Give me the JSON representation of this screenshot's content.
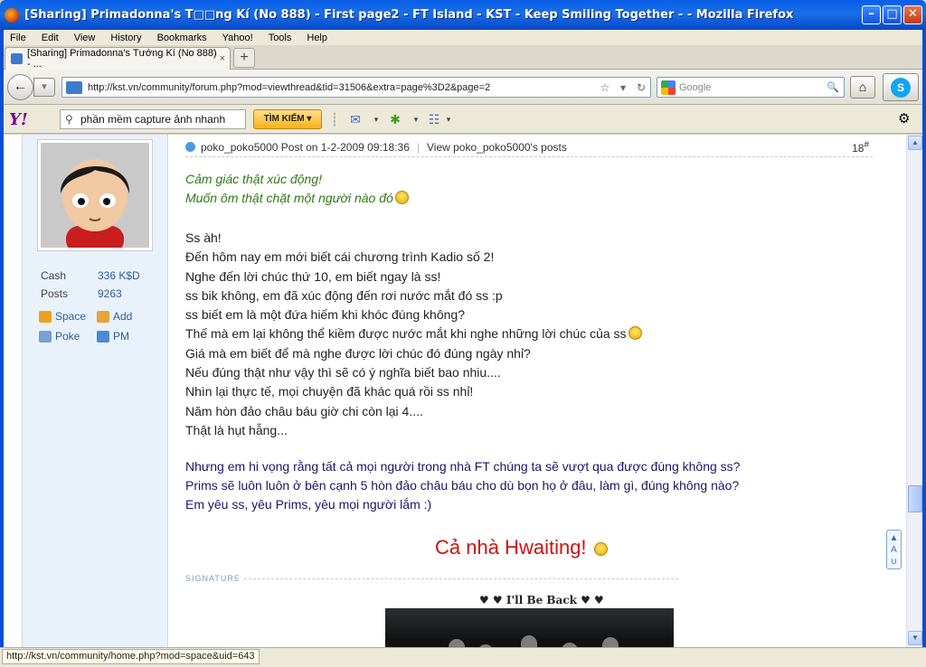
{
  "window": {
    "title": "[Sharing] Primadonna's T□□ng Kí (No 888) - First page2 - FT Island - KST - Keep Smiling Together - - Mozilla Firefox",
    "minimize": "–",
    "maximize": "□",
    "close": "✕"
  },
  "menu": [
    "File",
    "Edit",
    "View",
    "History",
    "Bookmarks",
    "Yahoo!",
    "Tools",
    "Help"
  ],
  "tabs": [
    {
      "label": "[Sharing] Primadonna's Tướng Kí (No 888) - ...",
      "close": "×"
    }
  ],
  "new_tab": "+",
  "nav": {
    "back": "←",
    "forward": "▾",
    "url": "http://kst.vn/community/forum.php?mod=viewthread&tid=31506&extra=page%3D2&page=2",
    "search_placeholder": "Google",
    "star": "☆",
    "dropdown": "▾",
    "reload": "↻",
    "home": "⌂",
    "skype": "S"
  },
  "yahoo": {
    "logo": "Y!",
    "search_value": "phần mềm capture ảnh nhanh",
    "search_button": "TÌM KIẾM ▾"
  },
  "profile": {
    "stats": [
      {
        "label": "Cash",
        "value": "336 K$D"
      },
      {
        "label": "Posts",
        "value": "9263"
      }
    ],
    "links": [
      [
        "Space",
        "Add"
      ],
      [
        "Poke",
        "PM"
      ]
    ]
  },
  "post": {
    "author": "poko_poko5000",
    "posted_on": "Post on 1-2-2009 09:18:36",
    "separator": "|",
    "view_posts": "View poko_poko5000's posts",
    "floor": "18",
    "floor_sup": "#",
    "green_lines": [
      "Cảm giác thật xúc động!",
      "Muốn ôm thật chặt một người nào đó"
    ],
    "body_lines": [
      "Ss àh!",
      "Đến hôm nay em mới biết cái chương trình Kadio số 2!",
      "Nghe đến lời chúc thứ 10, em biết ngay là ss!",
      "ss bik không, em đã xúc động đến rơi nước mắt đó ss :p",
      "ss biết em là một đứa hiếm khi khóc đúng không?",
      "Thế mà em lại không thể kiềm được nước mắt khi nghe những lời chúc của ss",
      "Giá mà em biết để mà nghe được lời chúc đó đúng ngày nhỉ?",
      "Nếu đúng thật như vậy thì sẽ có ý nghĩa biết bao nhiu....",
      "Nhìn lại thực tế, mọi chuyện đã khác quá rồi ss nhỉ!",
      "Năm hòn đảo châu báu giờ chi còn lại 4....",
      "Thật là hụt hẫng..."
    ],
    "purple_lines": [
      "Nhưng em hi vọng rằng tất cả mọi người trong nhà FT chúng ta sẽ vượt qua được đúng không ss?",
      "Prims sẽ luôn luôn ở bên cạnh 5 hòn đảo châu báu cho dù bọn họ ở đâu, làm gì, đúng không nào?",
      "Em yêu ss, yêu Prims, yêu mọi người lắm :)"
    ],
    "hwaiting": "Cả nhà Hwaiting!",
    "signature_label": "SIGNATURE",
    "sig_title": "♥ ♥ I'll Be Back ♥ ♥"
  },
  "floatbtn": "▲\nA\n∪",
  "status": "http://kst.vn/community/home.php?mod=space&uid=643",
  "colors": {
    "accent": "#2a5f9c",
    "green_text": "#2d7a14",
    "purple_text": "#1c1468",
    "hwaiting": "#d21010",
    "titlebar": "#0a5ee8"
  }
}
